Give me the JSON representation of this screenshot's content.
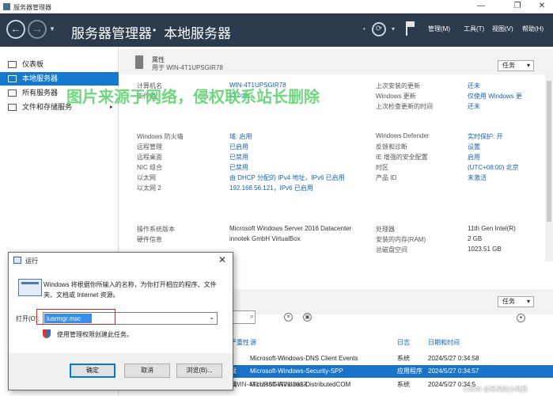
{
  "window": {
    "title": "服务器管理器",
    "minimize": "—",
    "maximize": "❐",
    "close": "✕"
  },
  "toolbar": {
    "breadcrumb_root": "服务器管理器",
    "breadcrumb_sep": "•",
    "breadcrumb_current": "本地服务器",
    "menus": [
      "管理(M)",
      "工具(T)",
      "视图(V)",
      "帮助(H)"
    ]
  },
  "sidebar": {
    "items": [
      {
        "label": "仪表板"
      },
      {
        "label": "本地服务器"
      },
      {
        "label": "所有服务器"
      },
      {
        "label": "文件和存储服务",
        "arrow": "▸"
      }
    ]
  },
  "properties": {
    "title": "属性",
    "subtitle": "用于 WIN-4T1UPSGIR78",
    "tasks": "任务",
    "rows_left": [
      {
        "key": "计算机名",
        "value": "WIN-4T1UPSGIR78"
      },
      {
        "key": "工作组",
        "value": "sz.com"
      },
      {
        "key": "Windows 防火墙",
        "value": "域: 启用"
      },
      {
        "key": "远程管理",
        "value": "已启用"
      },
      {
        "key": "远程桌面",
        "value": "已禁用"
      },
      {
        "key": "NIC 组合",
        "value": "已禁用"
      },
      {
        "key": "以太网",
        "value": "由 DHCP 分配的 IPv4 地址，IPv6 已启用"
      },
      {
        "key": "以太网 2",
        "value": "192.168.56.121，IPv6 已启用"
      },
      {
        "key": "操作系统版本",
        "value": "Microsoft Windows Server 2016 Datacenter"
      },
      {
        "key": "硬件信息",
        "value": "innotek GmbH VirtualBox"
      }
    ],
    "rows_right": [
      {
        "key": "上次安装的更新",
        "value": "还未"
      },
      {
        "key": "Windows 更新",
        "value": "仅使用 Windows 更"
      },
      {
        "key": "上次检查更新的时间",
        "value": "还未"
      },
      {
        "key": "Windows Defender",
        "value": "实时保护: 开"
      },
      {
        "key": "反馈和诊断",
        "value": "设置"
      },
      {
        "key": "IE 增强的安全配置",
        "value": "启用"
      },
      {
        "key": "时区",
        "value": "(UTC+08:00) 北京"
      },
      {
        "key": "产品 ID",
        "value": "未激活"
      },
      {
        "key": "处理器",
        "value": "11th Gen Intel(R)"
      },
      {
        "key": "安装的内存(RAM)",
        "value": "2 GB"
      },
      {
        "key": "总磁盘空间",
        "value": "1023.51 GB"
      }
    ]
  },
  "events": {
    "tasks": "任务",
    "columns": [
      "严重性",
      "源",
      "日志",
      "日期和时间"
    ],
    "rows": [
      {
        "severity": "",
        "source": "Microsoft-Windows-DNS Client Events",
        "log": "系统",
        "time": "2024/5/27 0:34:58"
      },
      {
        "severity": "误",
        "source": "Microsoft-Windows-Security-SPP",
        "log": "应用程序",
        "time": "2024/5/27 0:34:57"
      },
      {
        "severity": "误",
        "source": "Microsoft-Windows-DistributedCOM",
        "log": "系统",
        "time": "2024/5/27 0:34:5"
      }
    ],
    "partial_left": "WIN-4T1UPSGIR78 2023"
  },
  "run_dialog": {
    "title": "运行",
    "close": "✕",
    "description": "Windows 将根据你所输入的名称，为你打开相应的程序、文件夹、文档或 Internet 资源。",
    "open_label": "打开(O):",
    "input_value": "lusrmgr.msc",
    "admin_note": "使用管理权限创建此任务。",
    "ok": "确定",
    "cancel": "取消",
    "browse": "浏览(B)..."
  },
  "overlay": {
    "watermark": "图片来源于网络，侵权联系站长删除",
    "credit": "CSDN @呆呆的小鸣苏"
  },
  "colors": {
    "toolbar_bg": "#2b3a4c",
    "accent": "#1579d0",
    "link": "#1763b3",
    "watermark": "#58d06a"
  }
}
